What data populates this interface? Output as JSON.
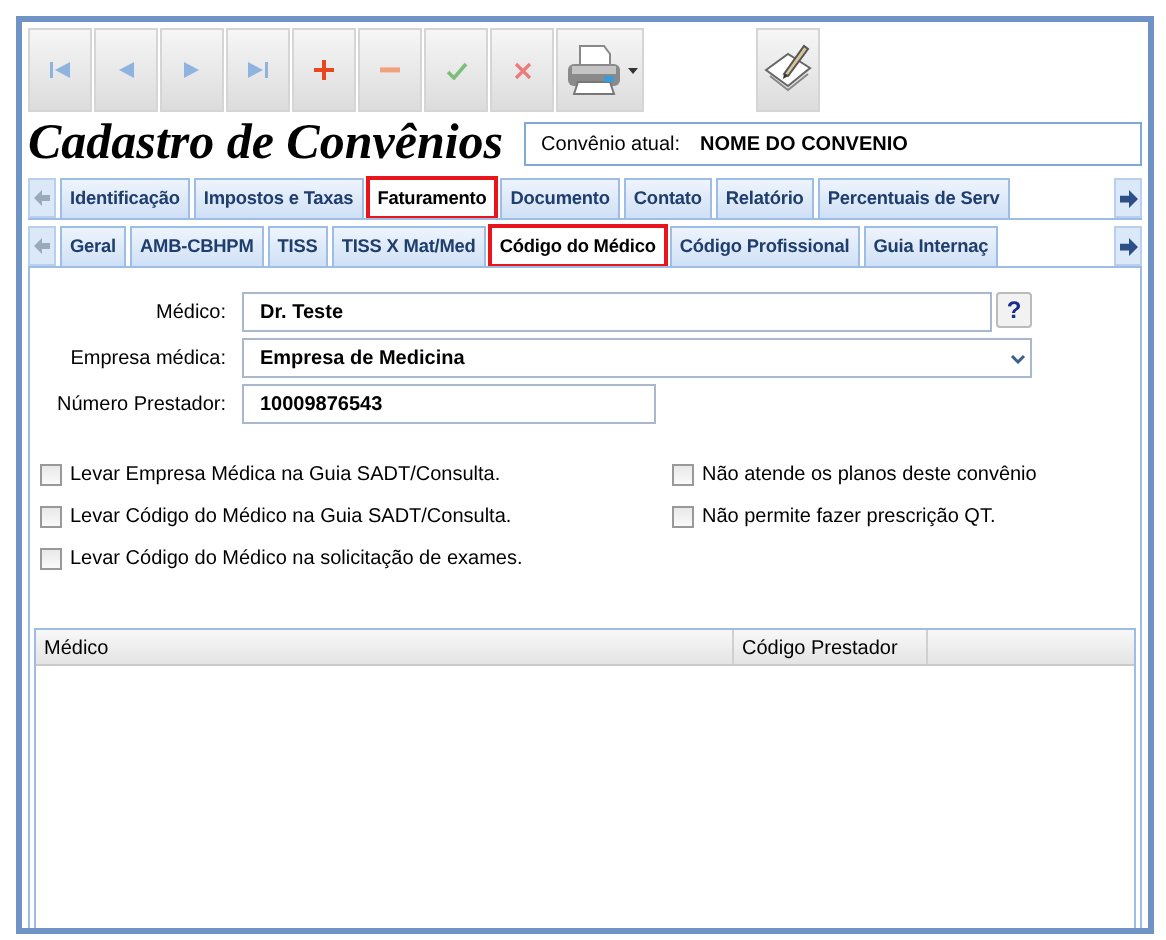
{
  "toolbar": {
    "buttons": [
      {
        "kind": "first"
      },
      {
        "kind": "prev"
      },
      {
        "kind": "next"
      },
      {
        "kind": "last"
      },
      {
        "kind": "add"
      },
      {
        "kind": "remove"
      },
      {
        "kind": "confirm"
      },
      {
        "kind": "cancel"
      },
      {
        "kind": "print"
      },
      {
        "kind": "edit"
      }
    ]
  },
  "title": "Cadastro de Convênios",
  "current": {
    "label": "Convênio atual:",
    "value": "NOME DO CONVENIO"
  },
  "tabs": [
    {
      "label": "Identificação",
      "selected": false,
      "highlighted": false
    },
    {
      "label": "Impostos e Taxas",
      "selected": false,
      "highlighted": false
    },
    {
      "label": "Faturamento",
      "selected": true,
      "highlighted": true
    },
    {
      "label": "Documento",
      "selected": false,
      "highlighted": false
    },
    {
      "label": "Contato",
      "selected": false,
      "highlighted": false
    },
    {
      "label": "Relatório",
      "selected": false,
      "highlighted": false
    },
    {
      "label": "Percentuais de Serv",
      "selected": false,
      "highlighted": false
    }
  ],
  "subtabs": [
    {
      "label": "Geral",
      "selected": false,
      "highlighted": false
    },
    {
      "label": "AMB-CBHPM",
      "selected": false,
      "highlighted": false
    },
    {
      "label": "TISS",
      "selected": false,
      "highlighted": false
    },
    {
      "label": "TISS X Mat/Med",
      "selected": false,
      "highlighted": false
    },
    {
      "label": "Código do Médico",
      "selected": true,
      "highlighted": true
    },
    {
      "label": "Código Profissional",
      "selected": false,
      "highlighted": false
    },
    {
      "label": "Guia Internaç",
      "selected": false,
      "highlighted": false
    }
  ],
  "fields": [
    {
      "label": "Médico:",
      "value": "Dr. Teste",
      "kind": "lookup",
      "button": "?"
    },
    {
      "label": "Empresa médica:",
      "value": "Empresa de Medicina",
      "kind": "select"
    },
    {
      "label": "Número Prestador:",
      "value": "10009876543",
      "kind": "text"
    }
  ],
  "options": {
    "left": [
      {
        "label": "Levar Empresa Médica na Guia SADT/Consulta.",
        "checked": false
      },
      {
        "label": "Levar Código do Médico na Guia SADT/Consulta.",
        "checked": false
      },
      {
        "label": "Levar Código do Médico na solicitação de exames.",
        "checked": false
      }
    ],
    "right": [
      {
        "label": "Não atende os planos deste convênio",
        "checked": false
      },
      {
        "label": "Não permite fazer prescrição QT.",
        "checked": false
      }
    ]
  },
  "table": {
    "columns": [
      "Médico",
      "Código Prestador"
    ]
  }
}
